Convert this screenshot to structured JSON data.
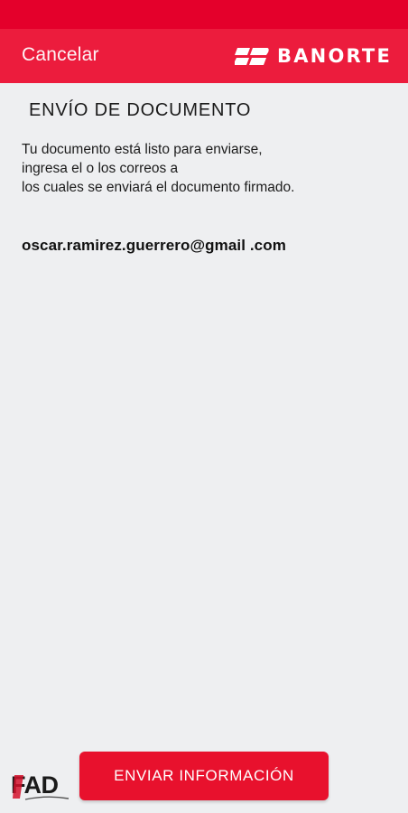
{
  "colors": {
    "brand_red": "#ec1c3d",
    "status_red": "#e4002b",
    "button_red": "#e8112d",
    "background": "#eeeff1"
  },
  "header": {
    "cancel_label": "Cancelar",
    "brand_name": "BANORTE",
    "brand_icon": "banorte-logo-icon"
  },
  "main": {
    "title": "ENVÍO DE DOCUMENTO",
    "description_lines": [
      "Tu documento está listo para enviarse,",
      "ingresa el o los correos a",
      "los cuales se enviará el documento firmado."
    ],
    "email": "oscar.ramirez.guerrero@gmail .com"
  },
  "footer": {
    "logo_text": "FAD",
    "submit_label": "ENVIAR INFORMACIÓN"
  }
}
